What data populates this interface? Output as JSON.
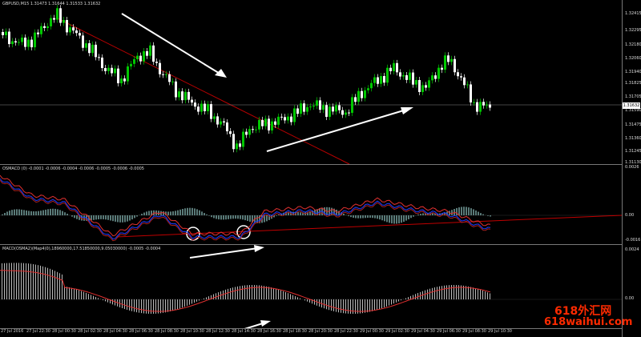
{
  "main_label": "GBPUSD,M15  1.31473 1.31644 1.31533 1.31632",
  "osma_label": "OSMACD (0) -0.0001 -0.0006 -0.0004 -0.0006 -0.0005 -0.0006 -0.0005",
  "macd_label": "MACD(OSMA2)(Map4(0),18960000,17.51850000,9.05030000) -0.0005 -0.0004",
  "price_ticks": [
    "1.32415",
    "1.32295",
    "1.32180",
    "1.32060",
    "1.31940",
    "1.31825",
    "1.31705",
    "1.31590",
    "1.31475",
    "1.31360",
    "1.31245",
    "1.31130"
  ],
  "current_price": "1.31632",
  "osma_ticks": [
    "0.0026",
    "0.00",
    "-0.0016"
  ],
  "macd_ticks": [
    "0.0024",
    "0.00"
  ],
  "time_labels": [
    "27 Jul 2016",
    "27 Jul 22:30",
    "28 Jul 00:30",
    "28 Jul 02:30",
    "28 Jul 04:30",
    "28 Jul 06:30",
    "28 Jul 08:30",
    "28 Jul 10:30",
    "28 Jul 12:30",
    "28 Jul 14:30",
    "28 Jul 16:30",
    "28 Jul 18:30",
    "28 Jul 20:30",
    "28 Jul 22:30",
    "29 Jul 00:30",
    "29 Jul 02:30",
    "29 Jul 04:30",
    "29 Jul 06:30",
    "29 Jul 08:30",
    "29 Jul 10:30"
  ],
  "watermark": {
    "line1": "618外汇网",
    "line2": "618waihui.com"
  },
  "colors": {
    "bull": "#00c800",
    "bear": "#ffffff",
    "trend": "#c00000",
    "macd_blue": "#1a3cff",
    "macd_red": "#e03030",
    "histo": "#5a7a78"
  }
}
